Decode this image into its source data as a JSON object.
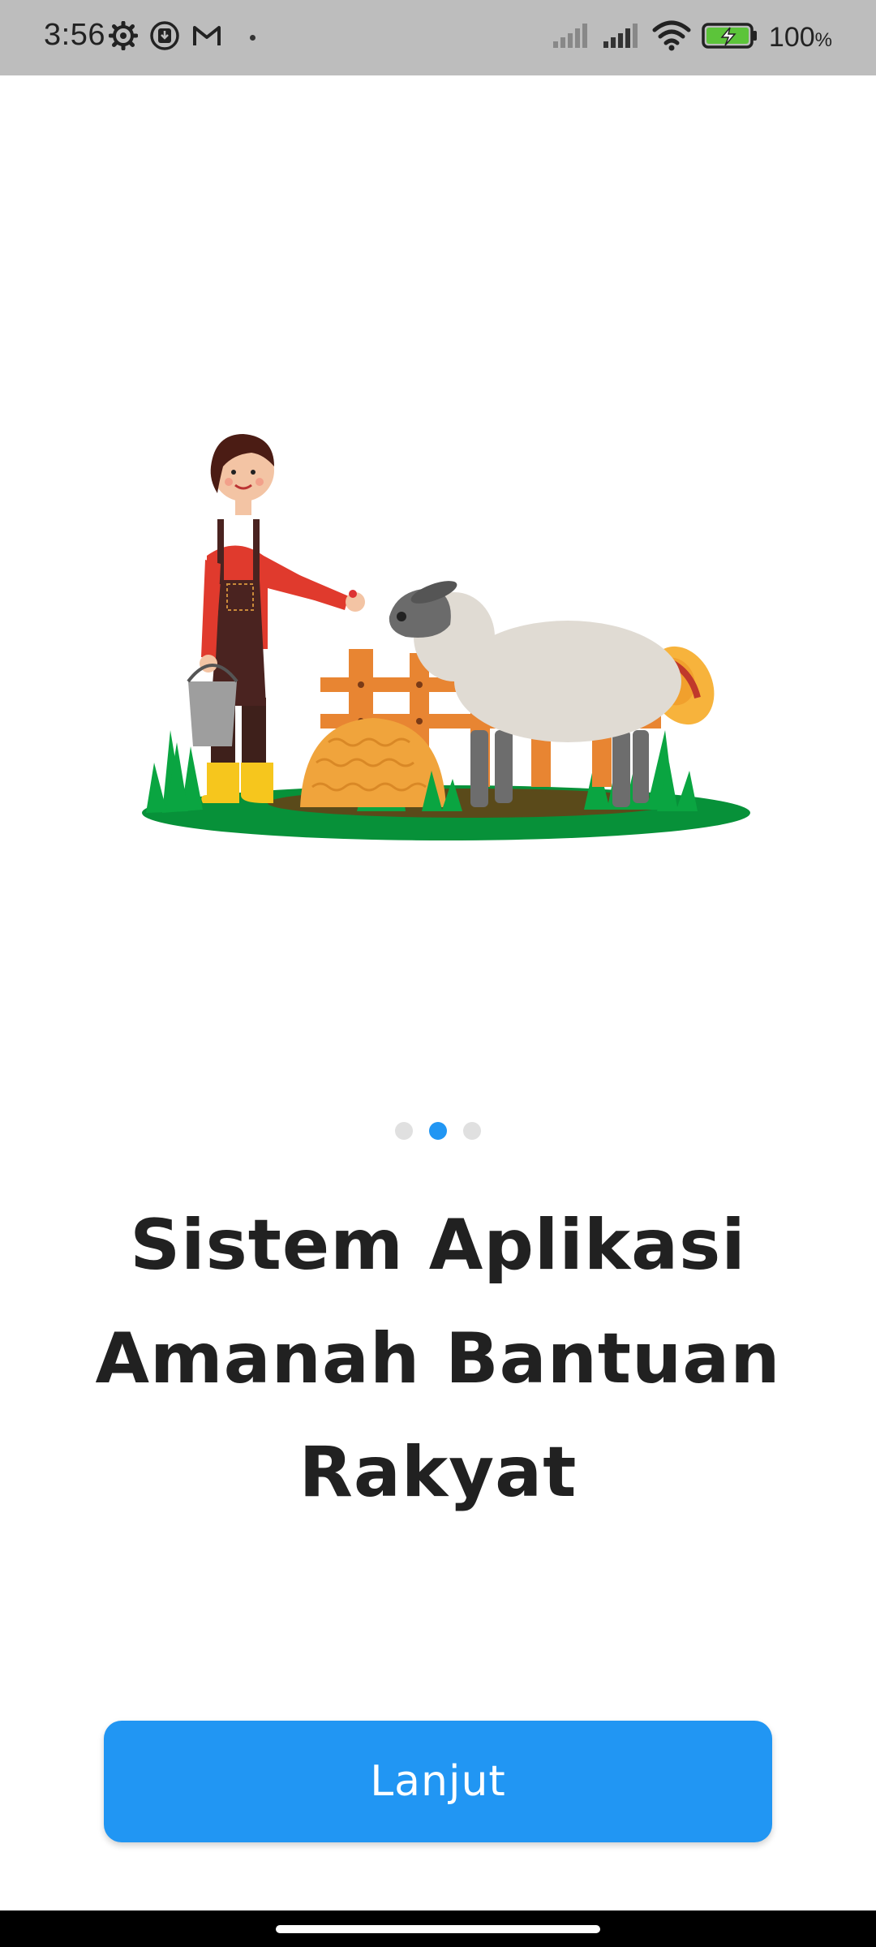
{
  "status_bar": {
    "time": "3:56",
    "battery_percent": "100",
    "battery_unit": "%",
    "icons": [
      "settings-gear-icon",
      "download-icon",
      "gmail-icon",
      "signal-icon",
      "signal-icon",
      "wifi-icon",
      "battery-charging-icon"
    ]
  },
  "onboarding": {
    "page_count": 3,
    "active_page": 2,
    "illustration": "farmer-feeding-sheep",
    "title": "Sistem Aplikasi Amanah Bantuan Rakyat",
    "next_button_label": "Lanjut"
  },
  "colors": {
    "accent": "#2196f3",
    "title": "#212121",
    "status_bar": "#bdbdbd",
    "dot_inactive": "#e0e0e0"
  }
}
